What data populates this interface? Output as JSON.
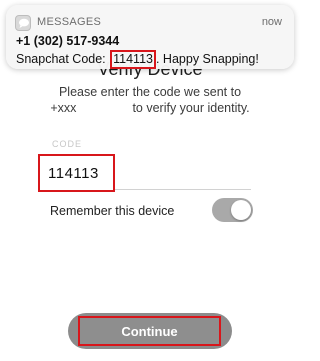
{
  "notification": {
    "app_name": "MESSAGES",
    "time": "now",
    "sender": "+1 (302) 517-9344",
    "body_prefix": "Snapchat Code: ",
    "code": "114113",
    "body_suffix": ". Happy Snapping!",
    "app_icon": "message-bubble-icon"
  },
  "page": {
    "title": "Verify Device",
    "instruction_line1": "Please enter the code we sent to",
    "instruction_line2_prefix": "+xxx",
    "instruction_line2_suffix": "to verify your identity."
  },
  "form": {
    "code_label": "CODE",
    "code_value": "114113",
    "remember_label": "Remember this device",
    "remember_enabled": true
  },
  "actions": {
    "continue_label": "Continue"
  },
  "colors": {
    "highlight": "#d8161b",
    "button": "#8e8e8e",
    "toggle": "#a9a9a9"
  }
}
